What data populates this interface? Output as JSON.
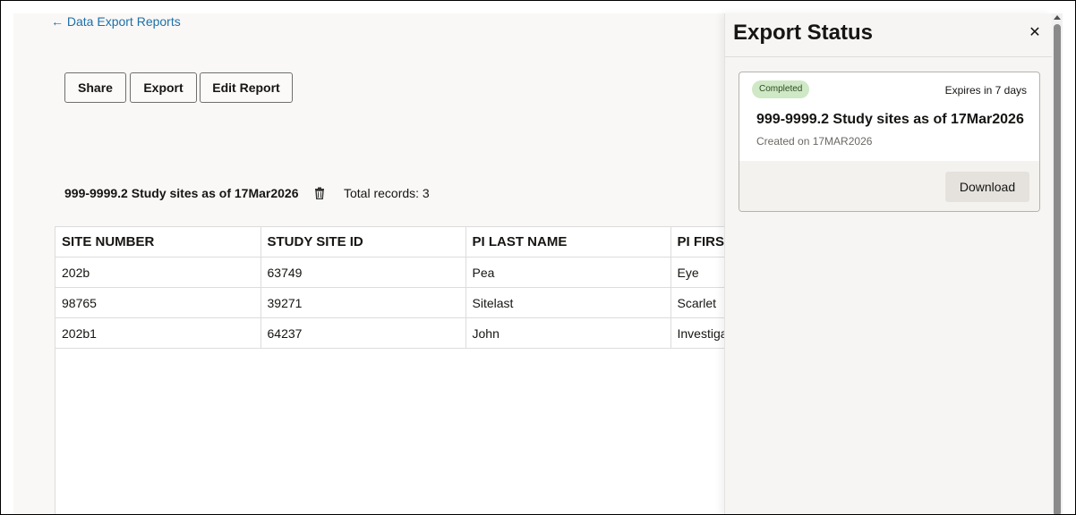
{
  "nav": {
    "back_link": "← Data Export Reports"
  },
  "toolbar": {
    "share_label": "Share",
    "export_label": "Export",
    "edit_label": "Edit Report"
  },
  "report": {
    "title": "999-9999.2 Study sites as of 17Mar2026",
    "delete_icon": "trash-icon",
    "total_records": "Total records: 3"
  },
  "table": {
    "headers": [
      "SITE NUMBER",
      "STUDY SITE ID",
      "PI LAST NAME",
      "PI FIRST"
    ],
    "rows": [
      [
        "202b",
        "63749",
        "Pea",
        "Eye"
      ],
      [
        "98765",
        "39271",
        "Sitelast",
        "Scarlet"
      ],
      [
        "202b1",
        "64237",
        "John",
        "Investiga"
      ]
    ]
  },
  "panel": {
    "title": "Export Status",
    "close_icon": "close-icon",
    "card": {
      "status": "Completed",
      "expires": "Expires in 7 days",
      "title": "999-9999.2 Study sites as of 17Mar2026",
      "created": "Created on 17MAR2026",
      "download_label": "Download"
    }
  },
  "colors": {
    "link": "#1f6fa8",
    "badge_bg": "#cfe8c6",
    "badge_text": "#2d4a22",
    "panel_bg": "#f6f5f3"
  }
}
